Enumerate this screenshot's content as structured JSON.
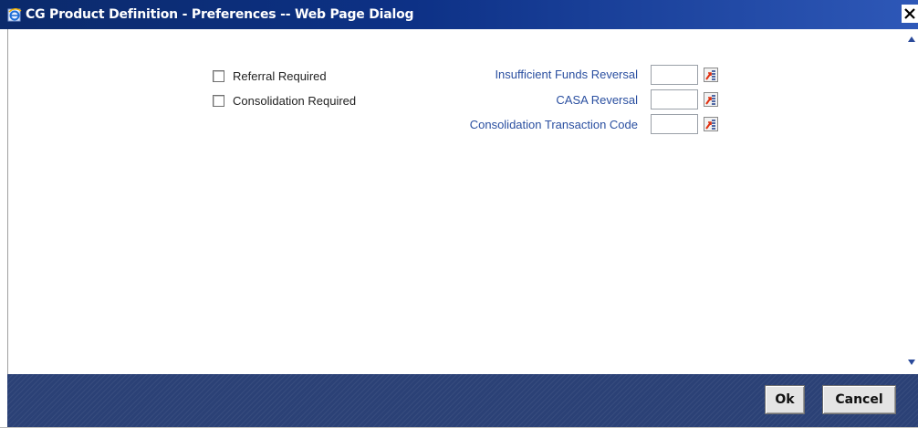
{
  "window": {
    "title": "CG Product Definition - Preferences -- Web Page Dialog",
    "close_label": "X"
  },
  "checkboxes": [
    {
      "label": "Referral Required",
      "checked": false
    },
    {
      "label": "Consolidation Required",
      "checked": false
    }
  ],
  "fields": [
    {
      "label": "Insufficient Funds Reversal",
      "value": ""
    },
    {
      "label": "CASA Reversal",
      "value": ""
    },
    {
      "label": "Consolidation Transaction Code",
      "value": ""
    }
  ],
  "footer": {
    "ok_label": "Ok",
    "cancel_label": "Cancel"
  },
  "colors": {
    "titlebar": "#0d3186",
    "field_label": "#2a4fa0",
    "footer": "#2b4176"
  },
  "icons": [
    "ie-page-icon",
    "close-icon",
    "scroll-up-icon",
    "scroll-down-icon",
    "list-of-values-icon"
  ]
}
